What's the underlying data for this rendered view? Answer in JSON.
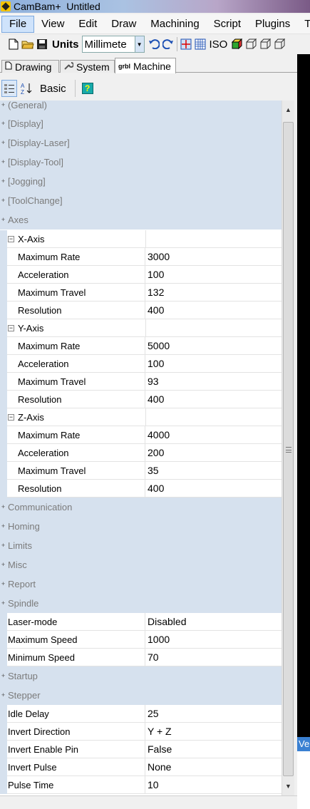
{
  "window": {
    "title": "CamBam+  Untitled"
  },
  "menu": [
    "File",
    "View",
    "Edit",
    "Draw",
    "Machining",
    "Script",
    "Plugins",
    "T"
  ],
  "toolbar": {
    "units_label": "Units",
    "units_value": "Millimete",
    "iso_label": "ISO"
  },
  "tabs": [
    "Drawing",
    "System",
    "Machine"
  ],
  "tab_icons": [
    "document-icon",
    "wrench-icon",
    "grbl-icon"
  ],
  "grbl_badge": "grbl",
  "prop_toolbar": {
    "basic_label": "Basic",
    "help_glyph": "?"
  },
  "right_panel": {
    "label": "Ve"
  },
  "categories_top": [
    "(General)",
    "[Display]",
    "[Display-Laser]",
    "[Display-Tool]",
    "[Jogging]",
    "[ToolChange]"
  ],
  "axes": {
    "label": "Axes",
    "groups": [
      {
        "label": "X-Axis",
        "props": [
          {
            "name": "Maximum Rate",
            "value": "3000"
          },
          {
            "name": "Acceleration",
            "value": "100"
          },
          {
            "name": "Maximum Travel",
            "value": "132"
          },
          {
            "name": "Resolution",
            "value": "400"
          }
        ]
      },
      {
        "label": "Y-Axis",
        "props": [
          {
            "name": "Maximum Rate",
            "value": "5000"
          },
          {
            "name": "Acceleration",
            "value": "100"
          },
          {
            "name": "Maximum Travel",
            "value": "93"
          },
          {
            "name": "Resolution",
            "value": "400"
          }
        ]
      },
      {
        "label": "Z-Axis",
        "props": [
          {
            "name": "Maximum Rate",
            "value": "4000"
          },
          {
            "name": "Acceleration",
            "value": "200"
          },
          {
            "name": "Maximum Travel",
            "value": "35"
          },
          {
            "name": "Resolution",
            "value": "400"
          }
        ]
      }
    ]
  },
  "categories_mid": [
    "Communication",
    "Homing",
    "Limits",
    "Misc",
    "Report"
  ],
  "spindle": {
    "label": "Spindle",
    "props": [
      {
        "name": "Laser-mode",
        "value": "Disabled"
      },
      {
        "name": "Maximum Speed",
        "value": "1000"
      },
      {
        "name": "Minimum Speed",
        "value": "70"
      }
    ]
  },
  "startup": {
    "label": "Startup"
  },
  "stepper": {
    "label": "Stepper",
    "props": [
      {
        "name": "Idle Delay",
        "value": "25"
      },
      {
        "name": "Invert Direction",
        "value": "Y + Z"
      },
      {
        "name": "Invert Enable Pin",
        "value": "False"
      },
      {
        "name": "Invert Pulse",
        "value": "None"
      },
      {
        "name": "Pulse Time",
        "value": "10"
      }
    ]
  },
  "glyphs": {
    "collapsed": "+",
    "expanded": "−",
    "scroll_up": "▲",
    "scroll_down": "▼",
    "dropdown": "▼"
  },
  "colors": {
    "category_bg": "#d6e1ee",
    "category_text": "#7b7b7b",
    "menu_active": "#cfe3fb"
  }
}
